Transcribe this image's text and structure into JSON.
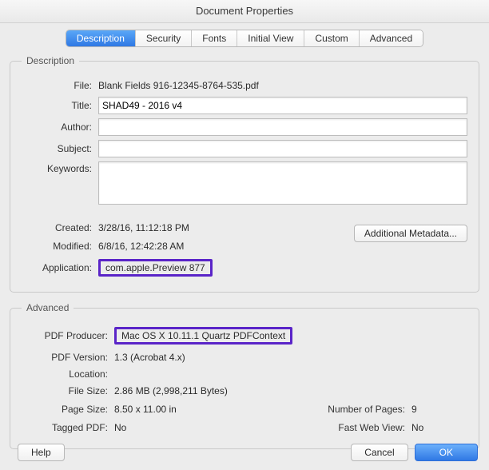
{
  "window": {
    "title": "Document Properties"
  },
  "tabs": [
    "Description",
    "Security",
    "Fonts",
    "Initial View",
    "Custom",
    "Advanced"
  ],
  "description": {
    "legend": "Description",
    "labels": {
      "file": "File:",
      "title": "Title:",
      "author": "Author:",
      "subject": "Subject:",
      "keywords": "Keywords:",
      "created": "Created:",
      "modified": "Modified:",
      "application": "Application:"
    },
    "file": "Blank Fields 916-12345-8764-535.pdf",
    "title_value": "SHAD49 - 2016 v4",
    "author_value": "",
    "subject_value": "",
    "keywords_value": "",
    "created": "3/28/16, 11:12:18 PM",
    "modified": "6/8/16, 12:42:28 AM",
    "application": "com.apple.Preview 877",
    "metadata_btn": "Additional Metadata..."
  },
  "advanced": {
    "legend": "Advanced",
    "labels": {
      "producer": "PDF Producer:",
      "version": "PDF Version:",
      "location": "Location:",
      "filesize": "File Size:",
      "pagesize": "Page Size:",
      "numpages": "Number of Pages:",
      "tagged": "Tagged PDF:",
      "fastweb": "Fast Web View:"
    },
    "producer": "Mac OS X 10.11.1 Quartz PDFContext",
    "version": "1.3 (Acrobat 4.x)",
    "location": "",
    "filesize": "2.86 MB (2,998,211 Bytes)",
    "pagesize": "8.50 x 11.00 in",
    "numpages": "9",
    "tagged": "No",
    "fastweb": "No"
  },
  "footer": {
    "help": "Help",
    "cancel": "Cancel",
    "ok": "OK"
  }
}
